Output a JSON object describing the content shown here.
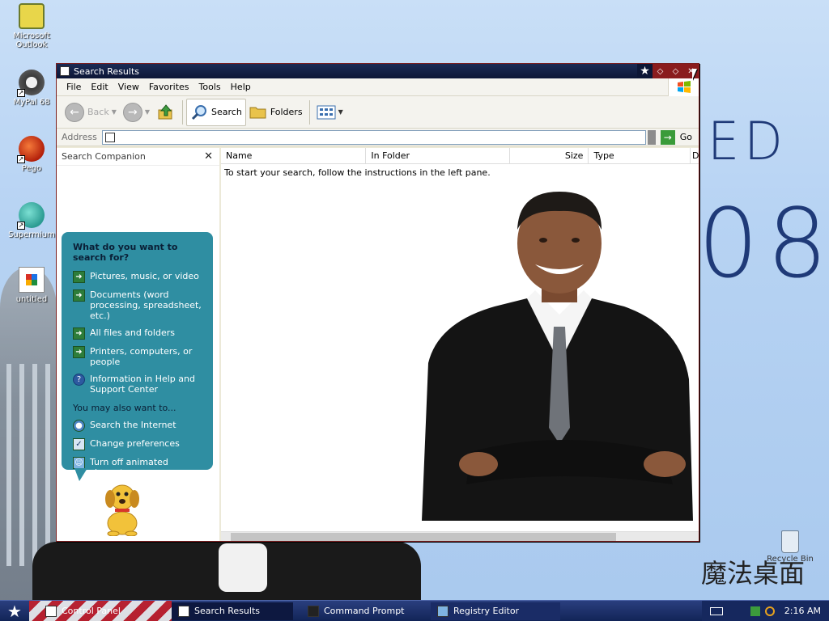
{
  "desktop": {
    "icons": [
      {
        "label": "Microsoft Outlook"
      },
      {
        "label": "MyPal 68"
      },
      {
        "label": "Pego"
      },
      {
        "label": "Supermium"
      },
      {
        "label": "untitled"
      }
    ],
    "bg_text_1": "ED",
    "bg_text_2": "08",
    "logo_text": "魔法桌面",
    "recycle_bin": "Recycle Bin"
  },
  "window": {
    "title": "Search Results",
    "menu": [
      "File",
      "Edit",
      "View",
      "Favorites",
      "Tools",
      "Help"
    ],
    "toolbar": {
      "back": "Back",
      "search": "Search",
      "folders": "Folders"
    },
    "address": {
      "label": "Address",
      "value": "",
      "go": "Go"
    },
    "companion": {
      "title": "Search Companion",
      "close": "✕",
      "question": "What do you want to search for?",
      "options": [
        "Pictures, music, or video",
        "Documents (word processing, spreadsheet, etc.)",
        "All files and folders",
        "Printers, computers, or people",
        "Information in Help and Support Center"
      ],
      "also_label": "You may also want to...",
      "also": [
        "Search the Internet",
        "Change preferences",
        "Turn off animated character"
      ]
    },
    "results": {
      "columns": [
        "Name",
        "In Folder",
        "Size",
        "Type",
        "D"
      ],
      "hint": "To start your search, follow the instructions in the left pane."
    }
  },
  "taskbar": {
    "tasks": [
      {
        "label": "Control Panel"
      },
      {
        "label": "Search Results"
      },
      {
        "label": "Command Prompt"
      },
      {
        "label": "Registry Editor"
      }
    ],
    "clock": "2:16 AM"
  },
  "colors": {
    "titlebar": "#0c1636",
    "companion_bubble": "#2f8ea2",
    "taskbar": "#122457",
    "bg_text": "#1f3a78"
  }
}
